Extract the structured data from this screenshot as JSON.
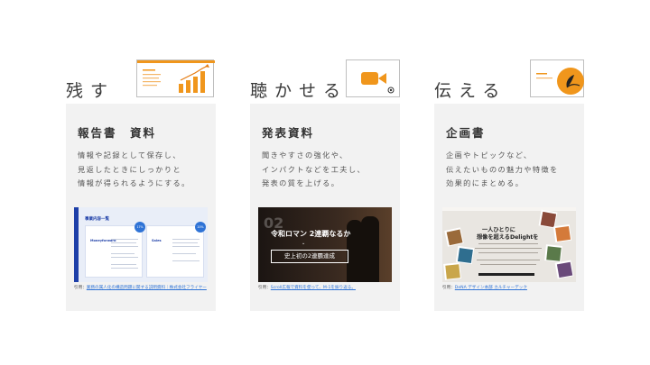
{
  "columns": [
    {
      "heading": "残す",
      "panel_title": "報告書　資料",
      "description": [
        "情報や記録として保存し、",
        "見返したときにしっかりと",
        "情報が得られるようにする。"
      ],
      "thumbnail": {
        "title": "事業内容一覧",
        "card_left_logo": "Moneyforward",
        "card_right_logo": "Sales",
        "badge_left": "17%",
        "badge_right": "20%"
      },
      "caption_prefix": "引用：",
      "caption_link": "業務の属人化の構造問題に関する説明資料｜株式会社フライヤー",
      "deco_icon": "slide-chart-icon"
    },
    {
      "heading": "聴かせる",
      "panel_title": "発表資料",
      "description": [
        "聞きやすさの強化や、",
        "インパクトなどを工夫し、",
        "発表の質を上げる。"
      ],
      "thumbnail": {
        "number": "02",
        "main_text": "令和ロマン 2連覇なるか",
        "arrow": "⌄",
        "box_text": "史上初の2連覇達成"
      },
      "caption_prefix": "引用：",
      "caption_link": "Scroll広報で資料を使って、M-1を振り返る。",
      "deco_icon": "video-camera-icon"
    },
    {
      "heading": "伝える",
      "panel_title": "企画書",
      "description": [
        "企画やトピックなど、",
        "伝えたいものの魅力や特徴を",
        "効果的にまとめる。"
      ],
      "thumbnail": {
        "main_text": "一人ひとりに",
        "main_text_2": "想像を超えるDelightを"
      },
      "caption_prefix": "引用：",
      "caption_link": "DeNA デザイン本部 カルチャーデック",
      "deco_icon": "document-icon"
    }
  ],
  "colors": {
    "accent_orange": "#f0961c",
    "panel_bg": "#f2f2f2",
    "link_blue": "#2f73d6"
  }
}
